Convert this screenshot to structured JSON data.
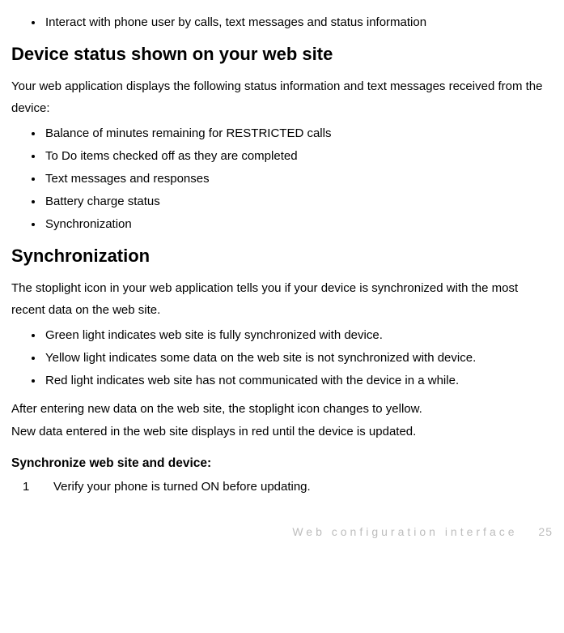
{
  "top_bullet": "Interact with phone user by calls, text messages and status information",
  "section1": {
    "heading": "Device status shown on your web site",
    "intro": "Your web application displays the following status information and text messages received from the device:",
    "bullets": [
      "Balance of minutes remaining for RESTRICTED calls",
      "To Do items checked off as they are completed",
      "Text messages and responses",
      "Battery charge status",
      "Synchronization"
    ]
  },
  "section2": {
    "heading": "Synchronization",
    "intro": "The stoplight icon in your web application tells you if your device is synchronized with the most recent data on the web site.",
    "bullets": [
      "Green light indicates web site is fully synchronized with device.",
      "Yellow light indicates some data on the web site is not synchronized with device.",
      "Red light indicates web site has not communicated with the device in a while."
    ],
    "after1": "After entering new data on the web site, the stoplight icon changes to yellow.",
    "after2": "New data entered in the web site displays in red until the device is updated.",
    "subhead": "Synchronize web site and device:",
    "steps": [
      {
        "num": "1",
        "text": "Verify your phone is turned ON before updating."
      }
    ]
  },
  "footer": {
    "label": "Web configuration interface",
    "page": "25"
  }
}
